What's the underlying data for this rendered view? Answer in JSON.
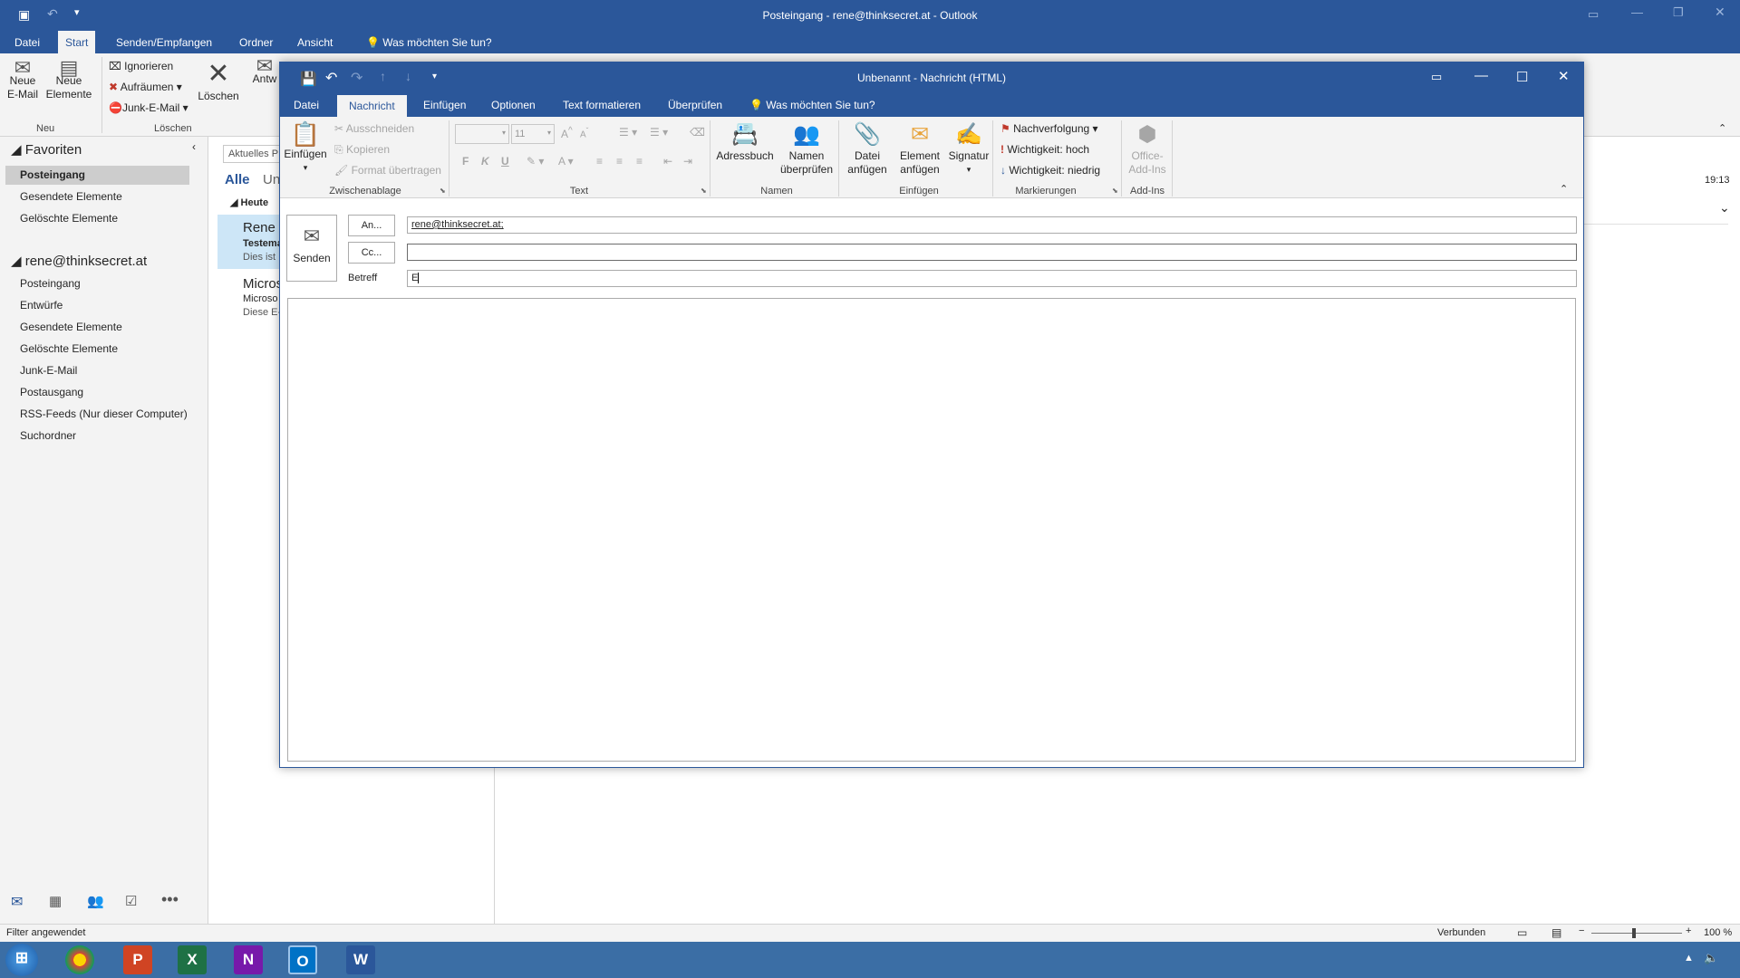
{
  "main": {
    "title": "Posteingang - rene@thinksecret.at - Outlook",
    "tabs": [
      "Datei",
      "Start",
      "Senden/Empfangen",
      "Ordner",
      "Ansicht"
    ],
    "tell_me": "Was möchten Sie tun?",
    "ribbon": {
      "neue_email": "Neue E-Mail",
      "neue_elemente": "Neue Elemente",
      "ignorieren": "Ignorieren",
      "aufraeumen": "Aufräumen",
      "junk": "Junk-E-Mail",
      "loeschen": "Löschen",
      "antworten": "Antw",
      "group_neu": "Neu",
      "group_loeschen": "Löschen"
    },
    "folders": {
      "favoriten_header": "Favoriten",
      "favoriten": [
        "Posteingang",
        "Gesendete Elemente",
        "Gelöschte Elemente"
      ],
      "account_header": "rene@thinksecret.at",
      "account": [
        "Posteingang",
        "Entwürfe",
        "Gesendete Elemente",
        "Gelöschte Elemente",
        "Junk-E-Mail",
        "Postausgang",
        "RSS-Feeds (Nur dieser Computer)",
        "Suchordner"
      ]
    },
    "msglist": {
      "search": "Aktuelles P",
      "filter_all": "Alle",
      "filter_unread": "Un",
      "group": "Heute",
      "items": [
        {
          "sender": "Rene F",
          "subject": "Testema",
          "preview": "Dies ist"
        },
        {
          "sender": "Micros",
          "subject": "Microso",
          "preview": "Diese E-"
        }
      ]
    },
    "reading": {
      "time": "19:13"
    },
    "status": {
      "filter": "Filter angewendet",
      "connection": "Verbunden",
      "zoom": "100 %"
    }
  },
  "compose": {
    "title": "Unbenannt - Nachricht (HTML)",
    "tabs": [
      "Datei",
      "Nachricht",
      "Einfügen",
      "Optionen",
      "Text formatieren",
      "Überprüfen"
    ],
    "tell_me": "Was möchten Sie tun?",
    "ribbon": {
      "einfuegen": "Einfügen",
      "ausschneiden": "Ausschneiden",
      "kopieren": "Kopieren",
      "format_uebertragen": "Format übertragen",
      "font_size": "11",
      "bold": "F",
      "italic": "K",
      "underline": "U",
      "adressbuch": "Adressbuch",
      "namen_ueberpruefen": "Namen überprüfen",
      "datei_anfuegen": "Datei anfügen",
      "element_anfuegen": "Element anfügen",
      "signatur": "Signatur",
      "nachverfolgung": "Nachverfolgung",
      "wichtigkeit_hoch": "Wichtigkeit: hoch",
      "wichtigkeit_niedrig": "Wichtigkeit: niedrig",
      "office_addins": "Office-Add-Ins",
      "groups": {
        "zwischenablage": "Zwischenablage",
        "text": "Text",
        "namen": "Namen",
        "einfuegen": "Einfügen",
        "markierungen": "Markierungen",
        "addins": "Add-Ins"
      }
    },
    "fields": {
      "senden": "Senden",
      "an_label": "An...",
      "an_value": "rene@thinksecret.at;",
      "cc_label": "Cc...",
      "cc_value": "",
      "betreff_label": "Betreff",
      "betreff_value": "E"
    }
  },
  "taskbar": {
    "apps": [
      "start-orb",
      "chrome",
      "powerpoint",
      "excel",
      "onenote",
      "outlook",
      "word"
    ]
  }
}
